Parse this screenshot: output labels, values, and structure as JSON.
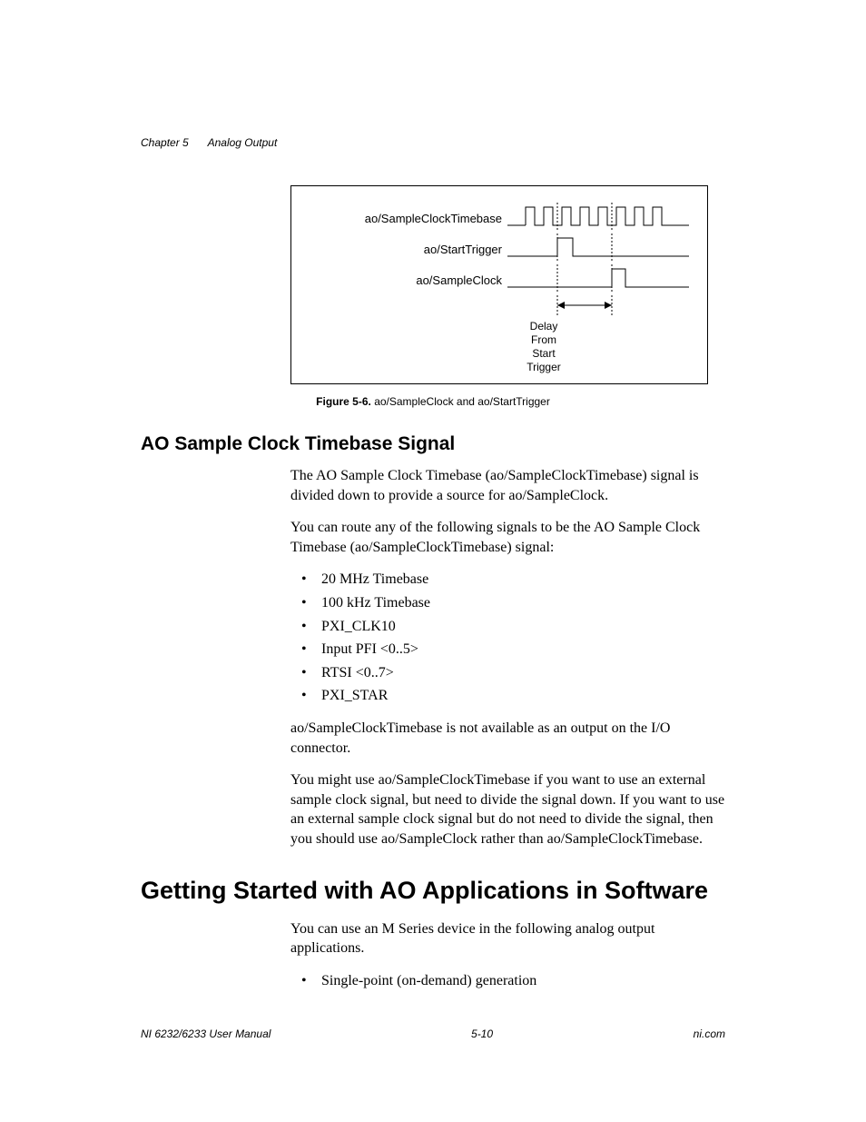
{
  "header": {
    "chapter_label": "Chapter 5",
    "chapter_title": "Analog Output"
  },
  "figure": {
    "signals": {
      "timebase": "ao/SampleClockTimebase",
      "start_trigger": "ao/StartTrigger",
      "sample_clock": "ao/SampleClock"
    },
    "delay_lines": [
      "Delay",
      "From",
      "Start",
      "Trigger"
    ],
    "caption_label": "Figure 5-6.",
    "caption_text": "ao/SampleClock and ao/StartTrigger"
  },
  "section_subhead": "AO Sample Clock Timebase Signal",
  "para1": "The AO Sample Clock Timebase (ao/SampleClockTimebase) signal is divided down to provide a source for ao/SampleClock.",
  "para2": "You can route any of the following signals to be the AO Sample Clock Timebase (ao/SampleClockTimebase) signal:",
  "signal_list": [
    "20 MHz Timebase",
    "100 kHz Timebase",
    "PXI_CLK10",
    "Input PFI <0..5>",
    "RTSI <0..7>",
    "PXI_STAR"
  ],
  "para3": "ao/SampleClockTimebase is not available as an output on the I/O connector.",
  "para4": "You might use ao/SampleClockTimebase if you want to use an external sample clock signal, but need to divide the signal down. If you want to use an external sample clock signal but do not need to divide the signal, then you should use ao/SampleClock rather than ao/SampleClockTimebase.",
  "main_heading": "Getting Started with AO Applications in Software",
  "para5": "You can use an M Series device in the following analog output applications.",
  "app_list": [
    "Single-point (on-demand) generation"
  ],
  "footer": {
    "left": "NI 6232/6233 User Manual",
    "center": "5-10",
    "right": "ni.com"
  }
}
